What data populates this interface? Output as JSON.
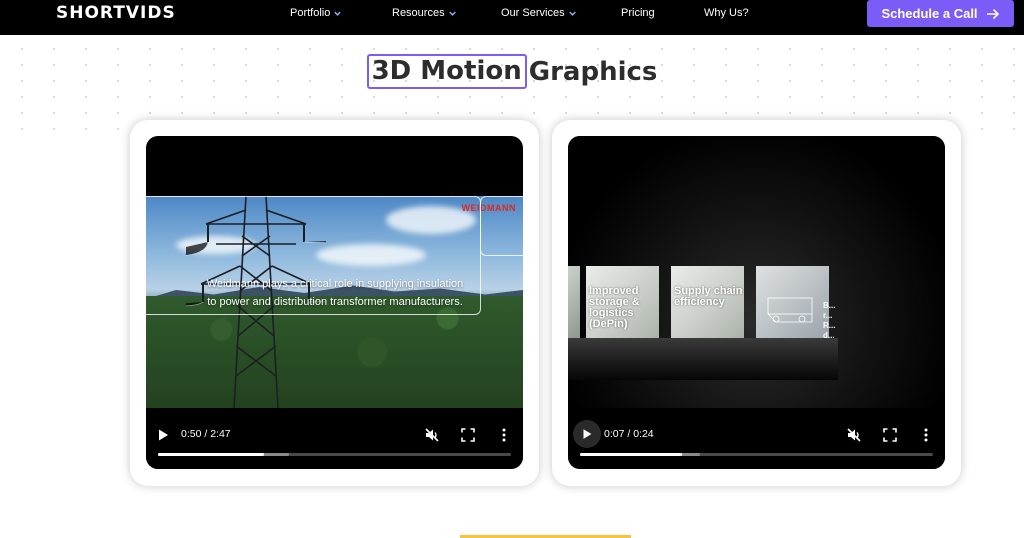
{
  "brand": {
    "logo": "SHORTVIDS"
  },
  "nav": {
    "items": [
      {
        "label": "Portfolio",
        "dropdown": true
      },
      {
        "label": "Resources",
        "dropdown": true
      },
      {
        "label": "Our Services",
        "dropdown": true
      },
      {
        "label": "Pricing",
        "dropdown": false
      },
      {
        "label": "Why Us?",
        "dropdown": false
      }
    ],
    "cta": {
      "label": "Schedule a Call",
      "icon": "arrow-right-icon"
    }
  },
  "section": {
    "title_highlight": "3D Motion",
    "title_rest": "Graphics"
  },
  "videos": [
    {
      "brand_text": "WEIDMANN",
      "caption_line1": "Weidmann plays a critical role in supplying insulation",
      "caption_line2": "to power and distribution transformer manufacturers.",
      "time": "0:50 / 2:47",
      "progress": 0.3,
      "buffered": 0.37,
      "muted": true
    },
    {
      "cube1_text": "Improved storage & logistics (DePin)",
      "cube2_text": "Supply chain efficiency",
      "cube3_text": "B... r... R... d...",
      "time": "0:07 / 0:24",
      "progress": 0.29,
      "buffered": 0.34,
      "muted": true
    }
  ],
  "colors": {
    "accent": "#7c5cf6",
    "nav_bg": "#000000",
    "brand_red": "#e3251d",
    "yellow_line": "#f5c43a"
  },
  "icons": [
    "chevron-down-icon",
    "arrow-right-icon",
    "play-icon",
    "mute-icon",
    "fullscreen-icon",
    "more-vert-icon"
  ]
}
